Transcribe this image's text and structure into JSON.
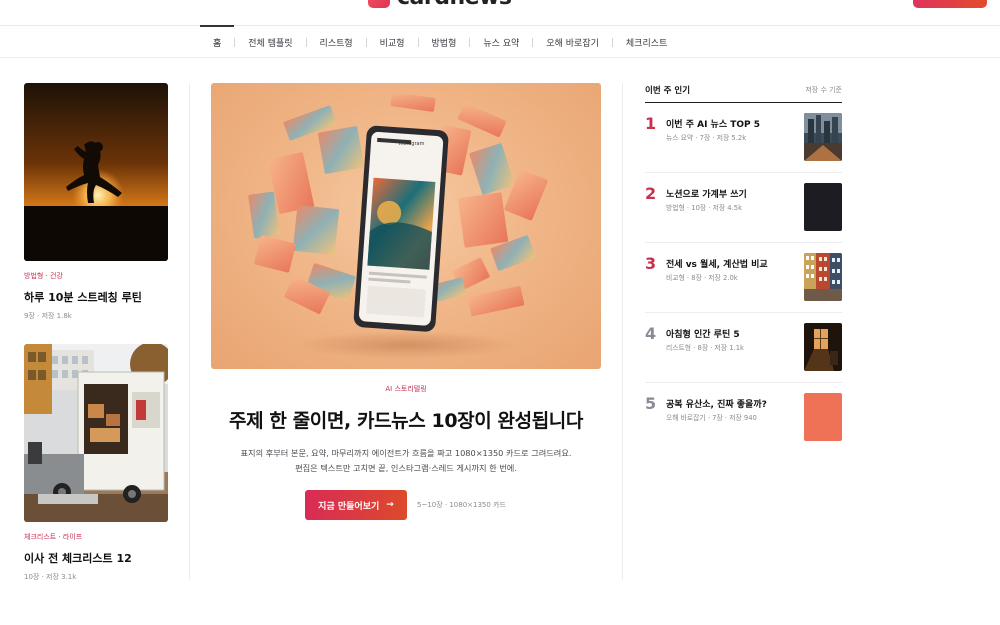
{
  "header": {
    "logo_text": "cardnews"
  },
  "nav": {
    "items": [
      "홈",
      "전체 템플릿",
      "리스트형",
      "비교형",
      "방법형",
      "뉴스 요약",
      "오해 바로잡기",
      "체크리스트"
    ]
  },
  "left_cards": [
    {
      "category": "방법형 · 건강",
      "title": "하루 10분 스트레칭 루틴",
      "meta": "9장 · 저장 1.8k"
    },
    {
      "category": "체크리스트 · 라이프",
      "title": "이사 전 체크리스트 12",
      "meta": "10장 · 저장 3.1k"
    }
  ],
  "hero": {
    "kicker": "AI 스토리텔링",
    "title": "주제 한 줄이면, 카드뉴스 10장이 완성됩니다",
    "description": "표지의 후부터 본문, 요약, 마무리까지 에이전트가 흐름을 짜고 1080×1350 카드로 그려드려요. 편집은 텍스트만 고치면 끝, 인스타그램·스레드 게시까지 한 번에.",
    "button_label": "지금 만들어보기",
    "button_arrow": "→",
    "meta": "5~10장 · 1080×1350 카드",
    "phone_brand": "Instagram"
  },
  "popular": {
    "title": "이번 주 인기",
    "sort_label": "저장 수 기준",
    "items": [
      {
        "rank": "1",
        "title": "이번 주 AI 뉴스 TOP 5",
        "meta": "뉴스 요약 · 7장 · 저장 5.2k"
      },
      {
        "rank": "2",
        "title": "노션으로 가계부 쓰기",
        "meta": "방법형 · 10장 · 저장 4.5k"
      },
      {
        "rank": "3",
        "title": "전세 vs 월세, 계산법 비교",
        "meta": "비교형 · 8장 · 저장 2.0k"
      },
      {
        "rank": "4",
        "title": "아침형 인간 루틴 5",
        "meta": "리스트형 · 8장 · 저장 1.1k"
      },
      {
        "rank": "5",
        "title": "공복 유산소, 진짜 좋을까?",
        "meta": "오해 바로잡기 · 7장 · 저장 940"
      }
    ]
  },
  "colors": {
    "accent": "#c8304e",
    "button_start": "#d92b55",
    "button_end": "#dc4a2c"
  }
}
